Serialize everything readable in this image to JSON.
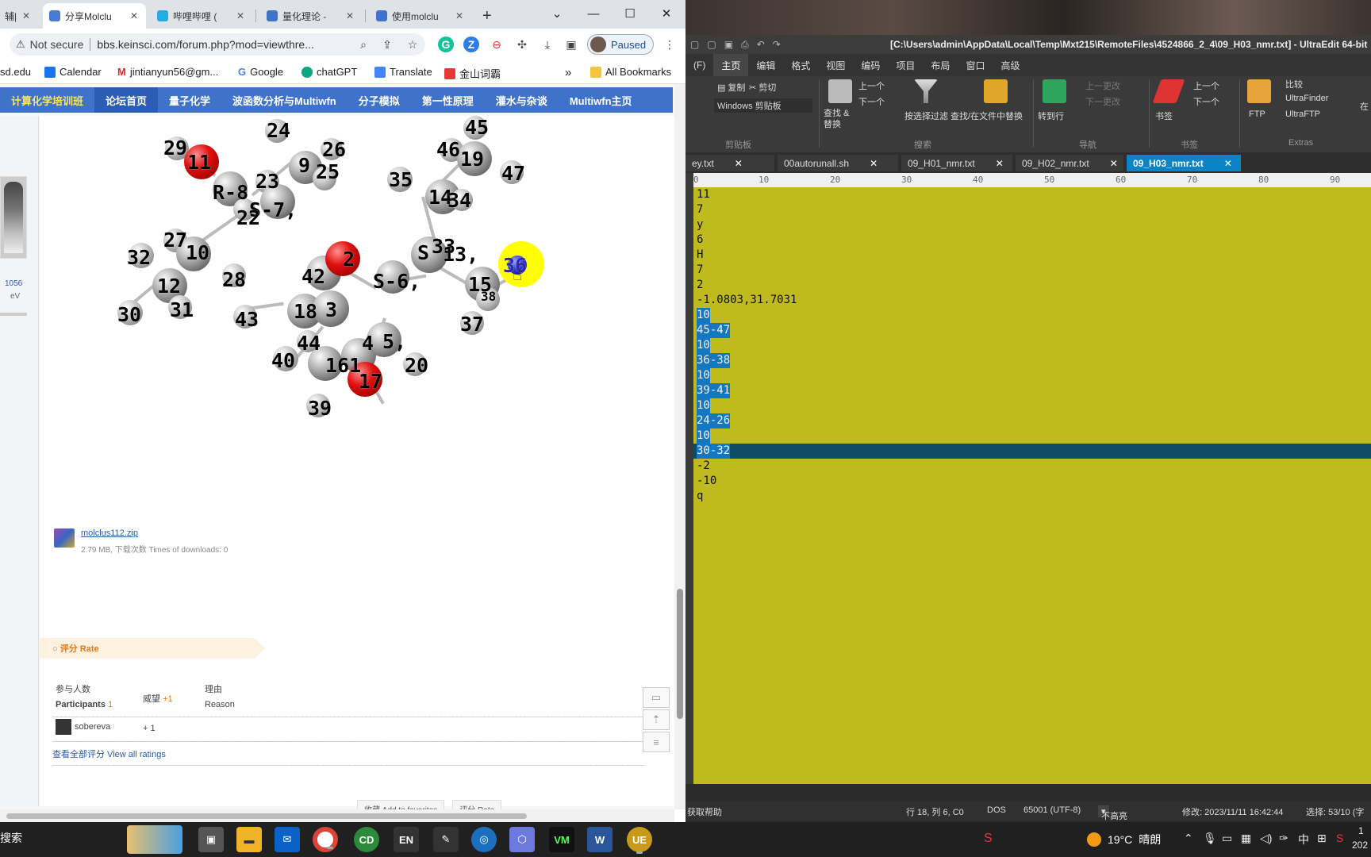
{
  "browser": {
    "tabs": [
      {
        "label": "辅|",
        "color": "#3f72c9"
      },
      {
        "label": "分享Molclu",
        "color": "#4a7bd4"
      },
      {
        "label": "哔哩哔哩 (",
        "color": "#23ade5"
      },
      {
        "label": "量化理论 -",
        "color": "#3f72c9"
      },
      {
        "label": "使用molclu",
        "color": "#3f72c9"
      }
    ],
    "new_tab": "+",
    "window_controls": {
      "dropdown": "⌄",
      "minimize": "—",
      "maximize": "☐",
      "close": "✕"
    },
    "address": {
      "warning": "⚠",
      "not_secure": "Not secure",
      "url": "bbs.keinsci.com/forum.php?mod=viewthre..."
    },
    "profile_label": "Paused",
    "bookmarks": [
      {
        "label": "sd.edu"
      },
      {
        "label": "Calendar"
      },
      {
        "label": "jintianyun56@gm..."
      },
      {
        "label": "Google"
      },
      {
        "label": "chatGPT"
      },
      {
        "label": "Translate"
      },
      {
        "label": "金山词霸"
      }
    ],
    "bookmarks_more": "»",
    "all_bookmarks": "All Bookmarks"
  },
  "forum": {
    "nav": [
      "计算化学培训班",
      "论坛首页",
      "量子化学",
      "波函数分析与Multiwfn",
      "分子模拟",
      "第一性原理",
      "灌水与杂谈",
      "Multiwfn主页"
    ],
    "user_stat_value": "1056",
    "user_stat_unit": "eV",
    "molecule_labels": {
      "l29": "29",
      "l11": "11",
      "l24": "24",
      "l9": "9",
      "l26": "26",
      "l25": "25",
      "l23": "23",
      "lR8": "R-8",
      "l7": "S-7,",
      "l22": "22",
      "l27": "27",
      "l10": "10",
      "l32": "32",
      "l28": "28",
      "l12": "12",
      "l31": "31",
      "l30": "30",
      "l42": "42",
      "l2": "2",
      "l43": "43",
      "l18": "18",
      "l3": "3",
      "l44": "44",
      "l40": "40",
      "l4": "4",
      "l5": "5,",
      "l16": "161",
      "l17": "17",
      "l39": "39",
      "l20": "20",
      "l6": "S-6,",
      "lS33": "S",
      "l33": "33",
      "l13": "13,",
      "l35": "35",
      "l14": "14",
      "l34": "34",
      "l45": "45",
      "l46": "46",
      "l19": "19",
      "l47": "47",
      "l36": "36",
      "l15": "15",
      "l38": "38",
      "l37": "37"
    },
    "attachment": {
      "filename": "molclus112.zip",
      "meta": "2.79 MB, 下载次数 Times of downloads: 0"
    },
    "rate": {
      "header": "○ 评分 Rate",
      "col_participants_cn": "参与人数",
      "col_participants_en": "Participants",
      "participants_count": "1",
      "col_prestige": "威望",
      "prestige_total": "+1",
      "col_reason_cn": "理由",
      "col_reason_en": "Reason",
      "rater_name": "sobereva",
      "rater_value": "+ 1",
      "view_all": "查看全部评分 View all ratings"
    },
    "bottom_buttons": [
      "收藏 Add to favorites",
      "评分 Rate"
    ]
  },
  "ue": {
    "title": "[C:\\Users\\admin\\AppData\\Local\\Temp\\Mxt215\\RemoteFiles\\4524866_2_4\\09_H03_nmr.txt] - UltraEdit 64-bit",
    "menu": [
      "(F)",
      "主页",
      "编辑",
      "格式",
      "视图",
      "编码",
      "项目",
      "布局",
      "窗口",
      "高级"
    ],
    "ribbon": {
      "copy": "复制",
      "cut": "剪切",
      "clipboard_select": "Windows 剪贴板",
      "find_replace": "查找 &\n替换",
      "prev": "上一个",
      "next": "下一个",
      "filter": "按选择过滤",
      "find_in_files": "查找/在文件中替换",
      "goto": "转到行",
      "prev_change": "上一更改",
      "next_change": "下一更改",
      "bookmark": "书签",
      "bm_prev": "上一个",
      "bm_next": "下一个",
      "ftp": "FTP",
      "compare": "比较",
      "ultrafinder": "UltraFinder",
      "ultraftp": "UltraFTP",
      "more": "在",
      "groups": [
        "剪贴板",
        "搜索",
        "导航",
        "书签",
        "Extras"
      ]
    },
    "file_tabs": [
      "ey.txt",
      "00autorunall.sh",
      "09_H01_nmr.txt",
      "09_H02_nmr.txt",
      "09_H03_nmr.txt"
    ],
    "ruler": [
      "0",
      "10",
      "20",
      "30",
      "40",
      "50",
      "60",
      "70",
      "80",
      "90"
    ],
    "lines": [
      "11",
      "7",
      "y",
      "6",
      "H",
      "7",
      "2",
      "-1.0803,31.7031",
      "10",
      "45-47",
      "10",
      "36-38",
      "10",
      "39-41",
      "10",
      "24-26",
      "10",
      "30-32",
      "-2",
      "-10",
      "q"
    ],
    "status": {
      "help": "获取帮助",
      "position": "行 18, 列 6, C0",
      "eol": "DOS",
      "encoding": "65001 (UTF-8)",
      "highlight": "不高亮",
      "modified": "修改:  2023/11/11 16:42:44",
      "selection": "选择: 53/10  (字"
    }
  },
  "taskbar": {
    "search": "搜索",
    "apps": [
      "edge",
      "files",
      "mail",
      "chrome",
      "CD",
      "EN",
      "tools",
      "browser",
      "vpn",
      "VM",
      "W",
      "UE"
    ],
    "weather_temp": "19°C",
    "weather_text": "晴朗",
    "time_partial": "1",
    "date_partial": "202"
  }
}
